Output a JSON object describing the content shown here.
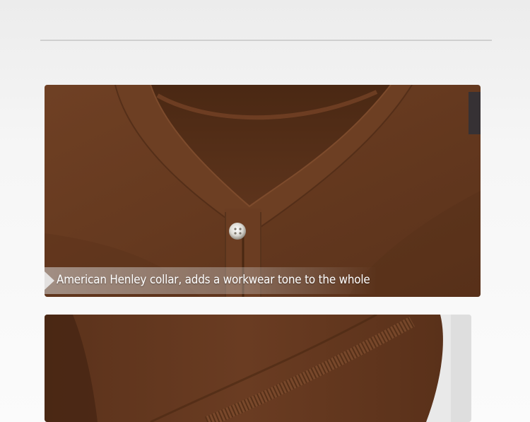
{
  "collar_section": {
    "caption": "American Henley collar, adds a workwear tone to the whole"
  },
  "colors": {
    "fabric_brown": "#6a3c22",
    "background": "#f5f5f5"
  }
}
